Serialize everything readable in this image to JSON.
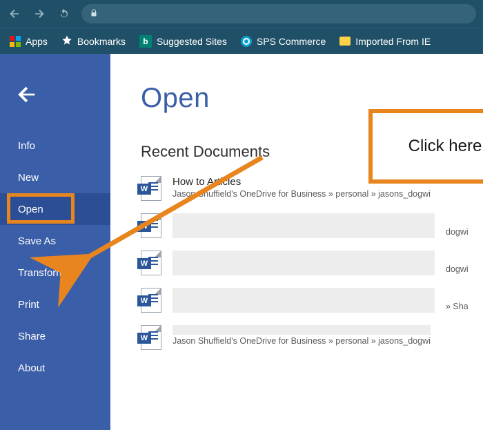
{
  "browser": {
    "url_text": "",
    "bookmarks": {
      "apps": "Apps",
      "bookmarks": "Bookmarks",
      "suggested": "Suggested Sites",
      "sps": "SPS Commerce",
      "imported": "Imported From IE"
    }
  },
  "sidebar": {
    "items": [
      "Info",
      "New",
      "Open",
      "Save As",
      "Transform",
      "Print",
      "Share",
      "About"
    ],
    "active_index": 2
  },
  "page": {
    "title": "Open",
    "section": "Recent Documents"
  },
  "docs": [
    {
      "title": "How to Articles",
      "path": "Jason Shuffield's OneDrive for Business » personal » jasons_dogwi"
    },
    {
      "title": "",
      "path": "dogwi"
    },
    {
      "title": "",
      "path": "dogwi"
    },
    {
      "title": "",
      "path": "» Sha"
    },
    {
      "title": "",
      "path": "Jason Shuffield's OneDrive for Business » personal » jasons_dogwi"
    }
  ],
  "annotation": {
    "label": "Click here"
  },
  "colors": {
    "accent": "#3b5ea9",
    "highlight": "#e8851e",
    "chrome": "#205067"
  }
}
